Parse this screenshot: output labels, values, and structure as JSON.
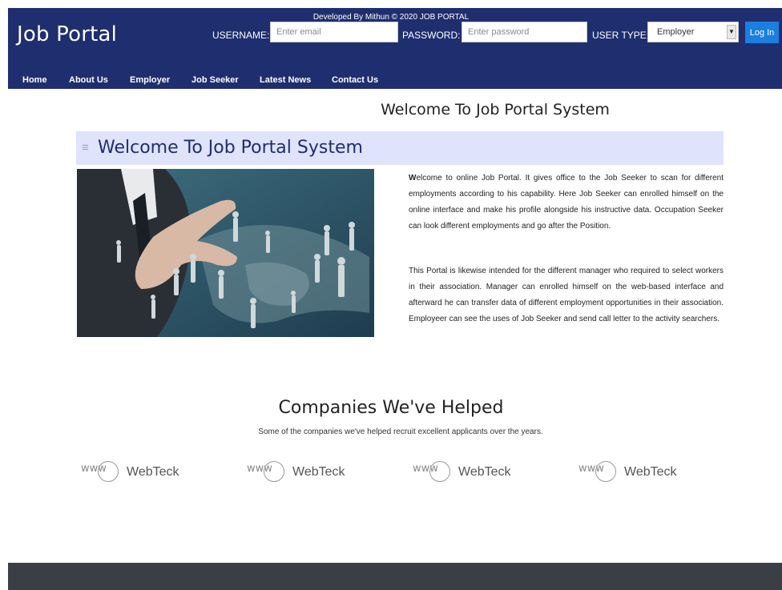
{
  "header": {
    "logo": "Job Portal",
    "username_label": "USERNAME:",
    "username_placeholder": "Enter email",
    "password_label": "PASSWORD:",
    "password_placeholder": "Enter password",
    "user_type_label": "USER TYPE:",
    "user_type_value": "Employer",
    "login_label": "Log In"
  },
  "nav": {
    "items": [
      {
        "label": "Home"
      },
      {
        "label": "About Us"
      },
      {
        "label": "Employer"
      },
      {
        "label": "Job Seeker"
      },
      {
        "label": "Latest News"
      },
      {
        "label": "Contact Us"
      }
    ]
  },
  "main": {
    "heading": "Welcome To Job Portal System",
    "banner_title": "Welcome To Job Portal System",
    "paragraph1_first": "W",
    "paragraph1_rest": "elcome to online Job Portal. It gives office to the Job Seeker to scan for different employments according to his capability. Here Job Seeker can enrolled himself on the online interface and make his profile alongside his instructive data. Occupation Seeker can look different employments and go after the Position.",
    "paragraph2": "This Portal is likewise intended for the different manager who required to select workers in their association. Manager can enrolled himself on the web-based interface and afterward he can transfer data of different employment opportunities in their association. Employeer can see the uses of Job Seeker and send call letter to the activity searchers."
  },
  "companies": {
    "title": "Companies We've Helped",
    "subtitle": "Some of the companies we've helped recruit excellent applicants over the years.",
    "items": [
      {
        "mark": "www",
        "name": "WebTeck"
      },
      {
        "mark": "www",
        "name": "WebTeck"
      },
      {
        "mark": "www",
        "name": "WebTeck"
      },
      {
        "mark": "www",
        "name": "WebTeck"
      }
    ]
  },
  "footer": {
    "text": "Developed By Mithun © 2020 JOB PORTAL"
  },
  "colors": {
    "header_bg": "#1f2e6e",
    "banner_bg": "#dfe3fb",
    "login_btn": "#1a7fe0",
    "footer_bg": "#3b3f45"
  }
}
